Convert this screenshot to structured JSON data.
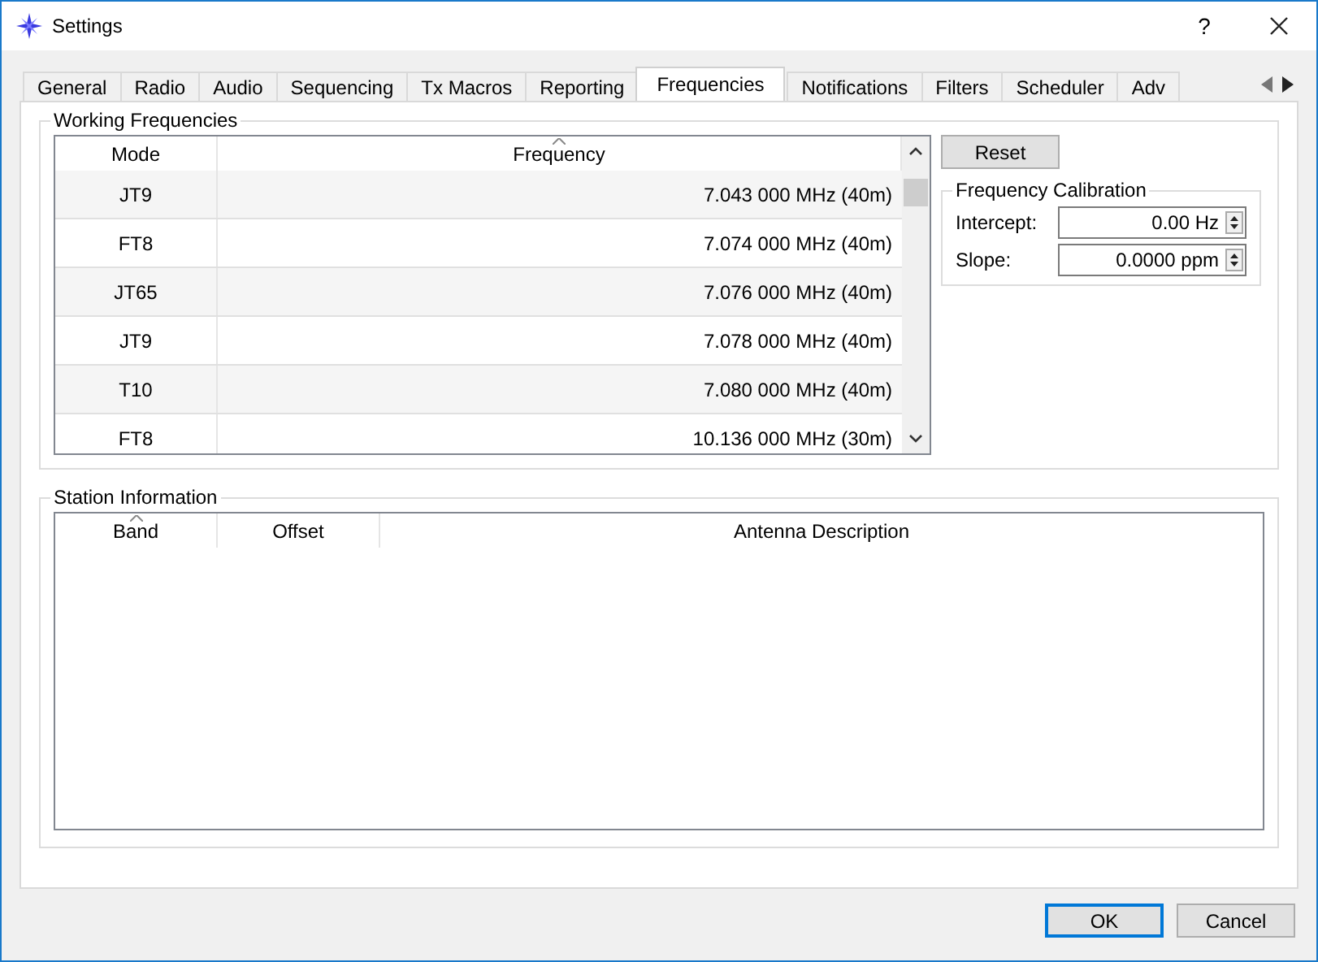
{
  "window": {
    "title": "Settings",
    "help": "?"
  },
  "tabs": [
    {
      "label": "General",
      "selected": false
    },
    {
      "label": "Radio",
      "selected": false
    },
    {
      "label": "Audio",
      "selected": false
    },
    {
      "label": "Sequencing",
      "selected": false
    },
    {
      "label": "Tx Macros",
      "selected": false
    },
    {
      "label": "Reporting",
      "selected": false
    },
    {
      "label": "Frequencies",
      "selected": true
    },
    {
      "label": "Notifications",
      "selected": false
    },
    {
      "label": "Filters",
      "selected": false
    },
    {
      "label": "Scheduler",
      "selected": false
    },
    {
      "label": "Adv",
      "selected": false
    }
  ],
  "working_frequencies": {
    "title": "Working Frequencies",
    "columns": [
      {
        "label": "Mode",
        "sorted": false
      },
      {
        "label": "Frequency",
        "sorted": true
      }
    ],
    "rows": [
      {
        "mode": "JT9",
        "frequency": "7.043 000 MHz (40m)"
      },
      {
        "mode": "FT8",
        "frequency": "7.074 000 MHz (40m)"
      },
      {
        "mode": "JT65",
        "frequency": "7.076 000 MHz (40m)"
      },
      {
        "mode": "JT9",
        "frequency": "7.078 000 MHz (40m)"
      },
      {
        "mode": "T10",
        "frequency": "7.080 000 MHz (40m)"
      },
      {
        "mode": "FT8",
        "frequency": "10.136 000 MHz (30m)"
      }
    ],
    "reset_button": "Reset",
    "calibration": {
      "title": "Frequency Calibration",
      "fields": [
        {
          "label": "Intercept:",
          "value": "0.00 Hz"
        },
        {
          "label": "Slope:",
          "value": "0.0000 ppm"
        }
      ]
    }
  },
  "station_information": {
    "title": "Station Information",
    "columns": [
      {
        "label": "Band",
        "sorted": true
      },
      {
        "label": "Offset",
        "sorted": false
      },
      {
        "label": "Antenna Description",
        "sorted": false
      }
    ]
  },
  "buttons": [
    {
      "label": "OK",
      "default": true
    },
    {
      "label": "Cancel",
      "default": false
    }
  ]
}
